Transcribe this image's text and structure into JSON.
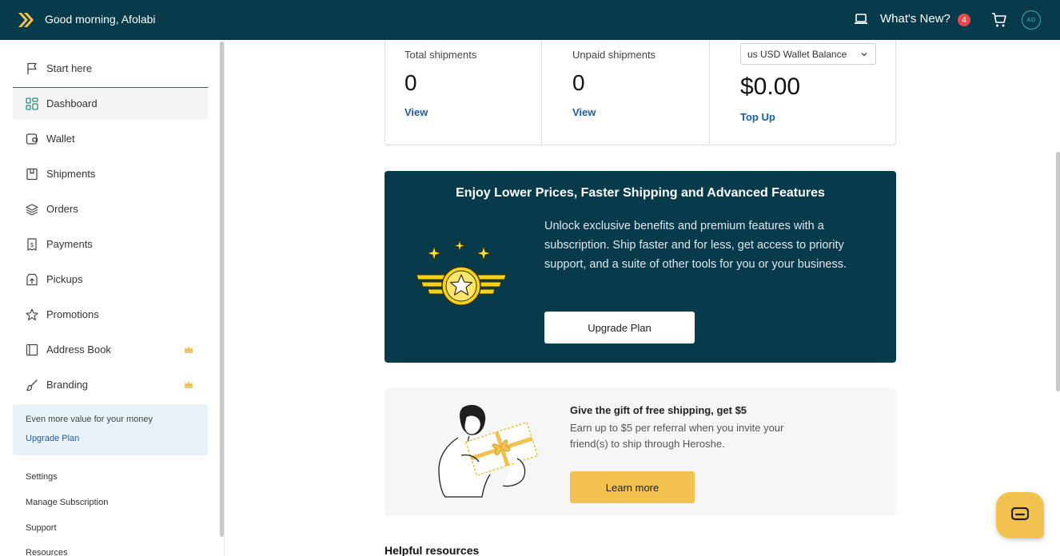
{
  "header": {
    "greeting": "Good morning, Afolabi",
    "whats_new": "What's New?",
    "notification_count": "4",
    "avatar_initials": "AO",
    "icons": [
      "double-chevron-logo-icon",
      "laptop-icon",
      "cart-icon"
    ]
  },
  "sidebar": {
    "items": [
      {
        "label": "Start here",
        "icon": "flag-icon"
      },
      {
        "label": "Dashboard",
        "icon": "grid-icon",
        "active": true
      },
      {
        "label": "Wallet",
        "icon": "wallet-icon"
      },
      {
        "label": "Shipments",
        "icon": "box-icon"
      },
      {
        "label": "Orders",
        "icon": "layers-icon"
      },
      {
        "label": "Payments",
        "icon": "receipt-dollar-icon"
      },
      {
        "label": "Pickups",
        "icon": "pickup-box-icon"
      },
      {
        "label": "Promotions",
        "icon": "star-icon"
      },
      {
        "label": "Address Book",
        "icon": "book-icon",
        "premium": true
      },
      {
        "label": "Branding",
        "icon": "brush-icon",
        "premium": true
      }
    ],
    "upsell": {
      "text": "Even more value for your money",
      "link": "Upgrade Plan"
    },
    "links": [
      "Settings",
      "Manage Subscription",
      "Support",
      "Resources"
    ]
  },
  "stats": {
    "total_label": "Total shipments",
    "total_value": "0",
    "total_link": "View",
    "unpaid_label": "Unpaid shipments",
    "unpaid_value": "0",
    "unpaid_link": "View",
    "wallet_select": "us USD Wallet Balance",
    "wallet_value": "$0.00",
    "wallet_link": "Top Up"
  },
  "promo": {
    "title": "Enjoy Lower Prices, Faster Shipping and Advanced Features",
    "text": "Unlock exclusive benefits and premium features with a subscription. Ship faster and for less, get access to priority support, and a suite of other tools for you or your business.",
    "button": "Upgrade Plan"
  },
  "referral": {
    "title": "Give the gift of free shipping, get $5",
    "text": "Earn up to $5 per referral when you invite your friend(s) to ship through Heroshe.",
    "button": "Learn more"
  },
  "helpful": {
    "title": "Helpful resources"
  },
  "colors": {
    "brand_dark": "#073b4c",
    "accent_yellow": "#f2c14e",
    "link_blue": "#1b5e9a",
    "badge_red": "#e5484d"
  }
}
